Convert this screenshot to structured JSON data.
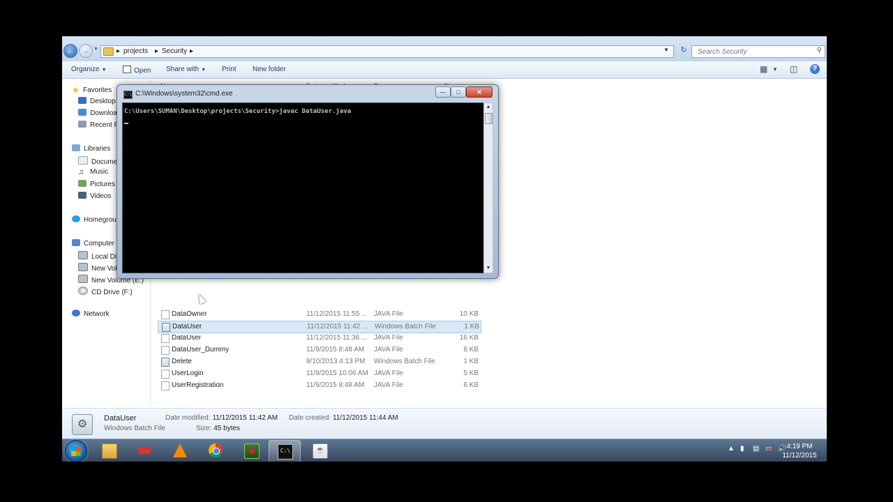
{
  "address": {
    "crumbs": [
      "projects",
      "Security"
    ],
    "search_placeholder": "Search Security"
  },
  "toolbar": {
    "organize": "Organize",
    "open": "Open",
    "share_with": "Share with",
    "print": "Print",
    "new_folder": "New folder"
  },
  "nav": {
    "favorites": "Favorites",
    "desktop": "Desktop",
    "downloads": "Download",
    "recent": "Recent Pl",
    "libraries": "Libraries",
    "documents": "Documer",
    "music": "Music",
    "pictures": "Pictures",
    "videos": "Videos",
    "homegroup": "Homegrou",
    "computer": "Computer",
    "local_disk": "Local Disk",
    "new_volume_d": "New Volu",
    "new_volume_e": "New Volume (E:)",
    "cd_drive": "CD Drive (F:)",
    "network": "Network"
  },
  "columns": {
    "name": "Name",
    "date": "Date modified",
    "type": "Type",
    "size": "Size"
  },
  "files": [
    {
      "name": "DataOwner",
      "date": "11/12/2015 11:55 ...",
      "type": "JAVA File",
      "size": "10 KB",
      "icon": "java-file"
    },
    {
      "name": "DataUser",
      "date": "11/12/2015 11:42 ...",
      "type": "Windows Batch File",
      "size": "1 KB",
      "icon": "batch-file",
      "selected": true
    },
    {
      "name": "DataUser",
      "date": "11/12/2015 11:36 ...",
      "type": "JAVA File",
      "size": "16 KB",
      "icon": "java-file"
    },
    {
      "name": "DataUser_Dummy",
      "date": "11/9/2015 8:48 AM",
      "type": "JAVA File",
      "size": "8 KB",
      "icon": "java-file"
    },
    {
      "name": "Delete",
      "date": "8/10/2013 4:13 PM",
      "type": "Windows Batch File",
      "size": "1 KB",
      "icon": "batch-file"
    },
    {
      "name": "UserLogin",
      "date": "11/9/2015 10:06 AM",
      "type": "JAVA File",
      "size": "5 KB",
      "icon": "java-file"
    },
    {
      "name": "UserRegistration",
      "date": "11/9/2015 8:48 AM",
      "type": "JAVA File",
      "size": "6 KB",
      "icon": "java-file"
    }
  ],
  "details": {
    "name": "DataUser",
    "type": "Windows Batch File",
    "date_modified_label": "Date modified:",
    "date_modified": "11/12/2015 11:42 AM",
    "date_created_label": "Date created:",
    "date_created": "11/12/2015 11:44 AM",
    "size_label": "Size:",
    "size": "45 bytes"
  },
  "cmd": {
    "title": "C:\\Windows\\system32\\cmd.exe",
    "line1": "C:\\Users\\SUMAN\\Desktop\\projects\\Security>javac DataUser.java"
  },
  "taskbar": {
    "time": "4:19 PM",
    "date": "11/12/2015"
  }
}
